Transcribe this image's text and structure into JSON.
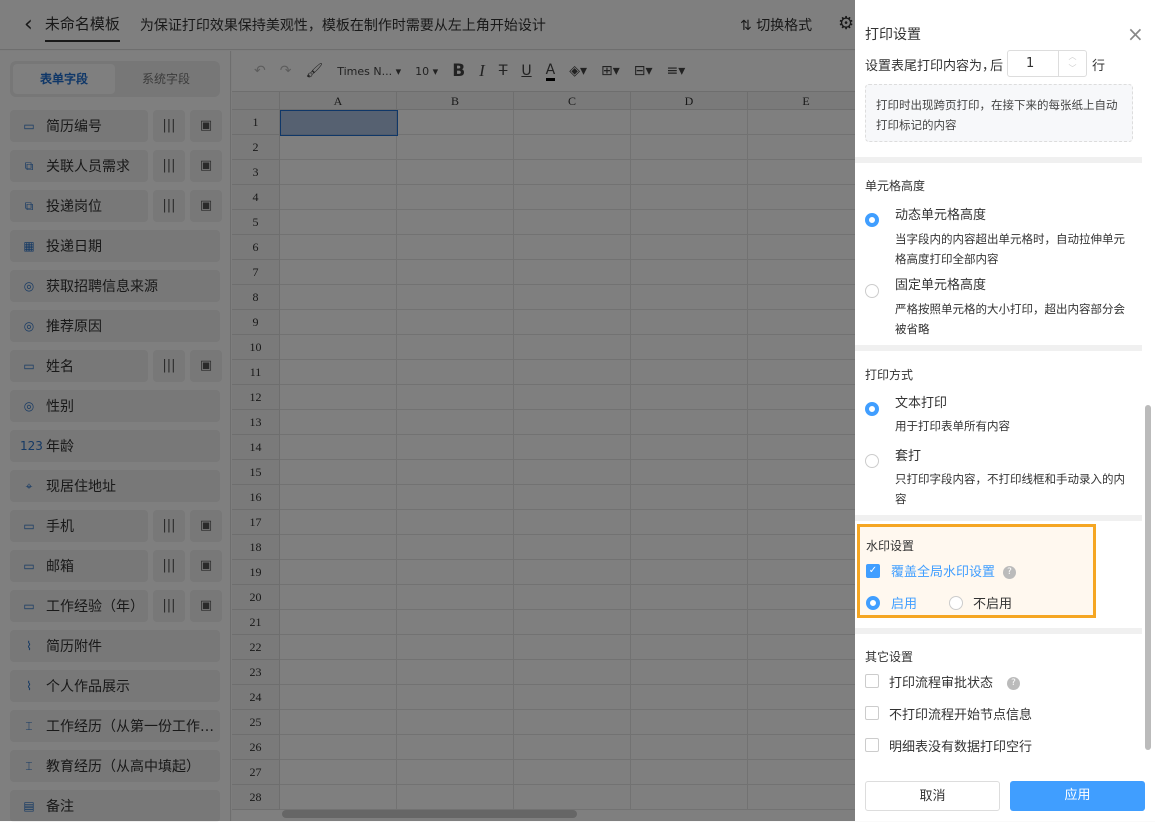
{
  "header": {
    "title": "未命名模板",
    "tip": "为保证打印效果保持美观性，模板在制作时需要从左上角开始设计",
    "switch_label": "切换格式"
  },
  "sidebar": {
    "tabs": [
      "表单字段",
      "系统字段"
    ],
    "fields": [
      {
        "label": "简历编号",
        "icon": "text-field-icon",
        "codes": true
      },
      {
        "label": "关联人员需求",
        "icon": "link-icon",
        "codes": true
      },
      {
        "label": "投递岗位",
        "icon": "link-icon",
        "codes": true
      },
      {
        "label": "投递日期",
        "icon": "calendar-icon",
        "codes": false
      },
      {
        "label": "获取招聘信息来源",
        "icon": "radio-icon",
        "codes": false
      },
      {
        "label": "推荐原因",
        "icon": "radio-icon",
        "codes": false
      },
      {
        "label": "姓名",
        "icon": "text-field-icon",
        "codes": true
      },
      {
        "label": "性别",
        "icon": "radio-icon",
        "codes": false
      },
      {
        "label": "年龄",
        "icon": "number-icon",
        "codes": false
      },
      {
        "label": "现居住地址",
        "icon": "location-icon",
        "codes": false
      },
      {
        "label": "手机",
        "icon": "text-field-icon",
        "codes": true
      },
      {
        "label": "邮箱",
        "icon": "text-field-icon",
        "codes": true
      },
      {
        "label": "工作经验（年）",
        "icon": "text-field-icon",
        "codes": true
      },
      {
        "label": "简历附件",
        "icon": "attachment-icon",
        "codes": false
      },
      {
        "label": "个人作品展示",
        "icon": "attachment-icon",
        "codes": false
      },
      {
        "label": "工作经历（从第一份工作…",
        "icon": "subform-icon",
        "codes": false
      },
      {
        "label": "教育经历（从高中填起）",
        "icon": "subform-icon",
        "codes": false
      },
      {
        "label": "备注",
        "icon": "textarea-icon",
        "codes": false
      }
    ]
  },
  "toolbar": {
    "font": "Times N...",
    "size": "10"
  },
  "sheet": {
    "columns": [
      "A",
      "B",
      "C",
      "D",
      "E"
    ],
    "rows": 28
  },
  "panel": {
    "title": "打印设置",
    "footer_label": "设置表尾打印内容为，",
    "after": "后",
    "footer_rows": "1",
    "rows_unit": "行",
    "footer_hint": "打印时出现跨页打印，在接下来的每张纸上自动打印标记的内容",
    "cell_height": {
      "title": "单元格高度",
      "options": [
        {
          "label": "动态单元格高度",
          "desc": "当字段内的内容超出单元格时，自动拉伸单元格高度打印全部内容",
          "checked": true
        },
        {
          "label": "固定单元格高度",
          "desc": "严格按照单元格的大小打印，超出内容部分会被省略",
          "checked": false
        }
      ]
    },
    "print_mode": {
      "title": "打印方式",
      "options": [
        {
          "label": "文本打印",
          "desc": "用于打印表单所有内容",
          "checked": true
        },
        {
          "label": "套打",
          "desc": "只打印字段内容，不打印线框和手动录入的内容",
          "checked": false
        }
      ]
    },
    "watermark": {
      "title": "水印设置",
      "override_label": "覆盖全局水印设置",
      "override_checked": true,
      "enable": "启用",
      "disable": "不启用",
      "enabled": true
    },
    "other": {
      "title": "其它设置",
      "options": [
        {
          "label": "打印流程审批状态",
          "help": true
        },
        {
          "label": "不打印流程开始节点信息",
          "help": false
        },
        {
          "label": "明细表没有数据打印空行",
          "help": false
        }
      ]
    },
    "cancel": "取消",
    "apply": "应用"
  },
  "colors": {
    "primary": "#409eff",
    "highlight": "#f5a623"
  }
}
